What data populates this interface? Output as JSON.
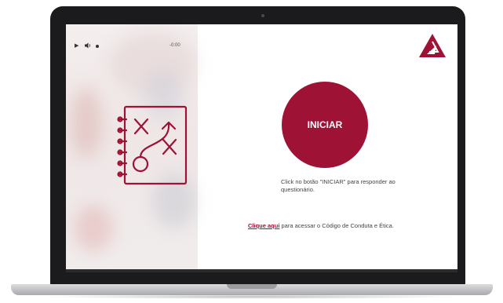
{
  "audio_player": {
    "play_icon": "play-icon",
    "volume_icon": "volume-icon",
    "time": "-0:00"
  },
  "start_button": {
    "label": "INICIAR"
  },
  "instructions": {
    "text": "Click no botão \"INICIAR\" para responder ao questionário."
  },
  "code_of_conduct": {
    "link_label": "Clique aqui",
    "text": " para acessar o Código de Conduta e Ética."
  },
  "colors": {
    "accent": "#9e1235"
  },
  "icons": {
    "logo": "triangle-logo-icon",
    "illustration": "strategy-plan-icon"
  }
}
